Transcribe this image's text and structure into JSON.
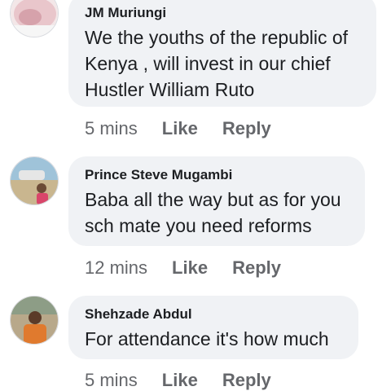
{
  "comments": [
    {
      "author": "JM Muriungi",
      "text": "We the youths of the republic of Kenya , will invest in our chief Hustler William Ruto",
      "time": "5 mins",
      "like_label": "Like",
      "reply_label": "Reply"
    },
    {
      "author": "Prince Steve Mugambi",
      "text": "Baba all the way but as for you sch mate you need reforms",
      "time": "12 mins",
      "like_label": "Like",
      "reply_label": "Reply"
    },
    {
      "author": "Shehzade Abdul",
      "text": "For attendance it's how much",
      "time": "5 mins",
      "like_label": "Like",
      "reply_label": "Reply"
    }
  ],
  "colors": {
    "bubble_bg": "#f0f2f5",
    "meta_text": "#65676b",
    "primary_text": "#1c1e21"
  }
}
